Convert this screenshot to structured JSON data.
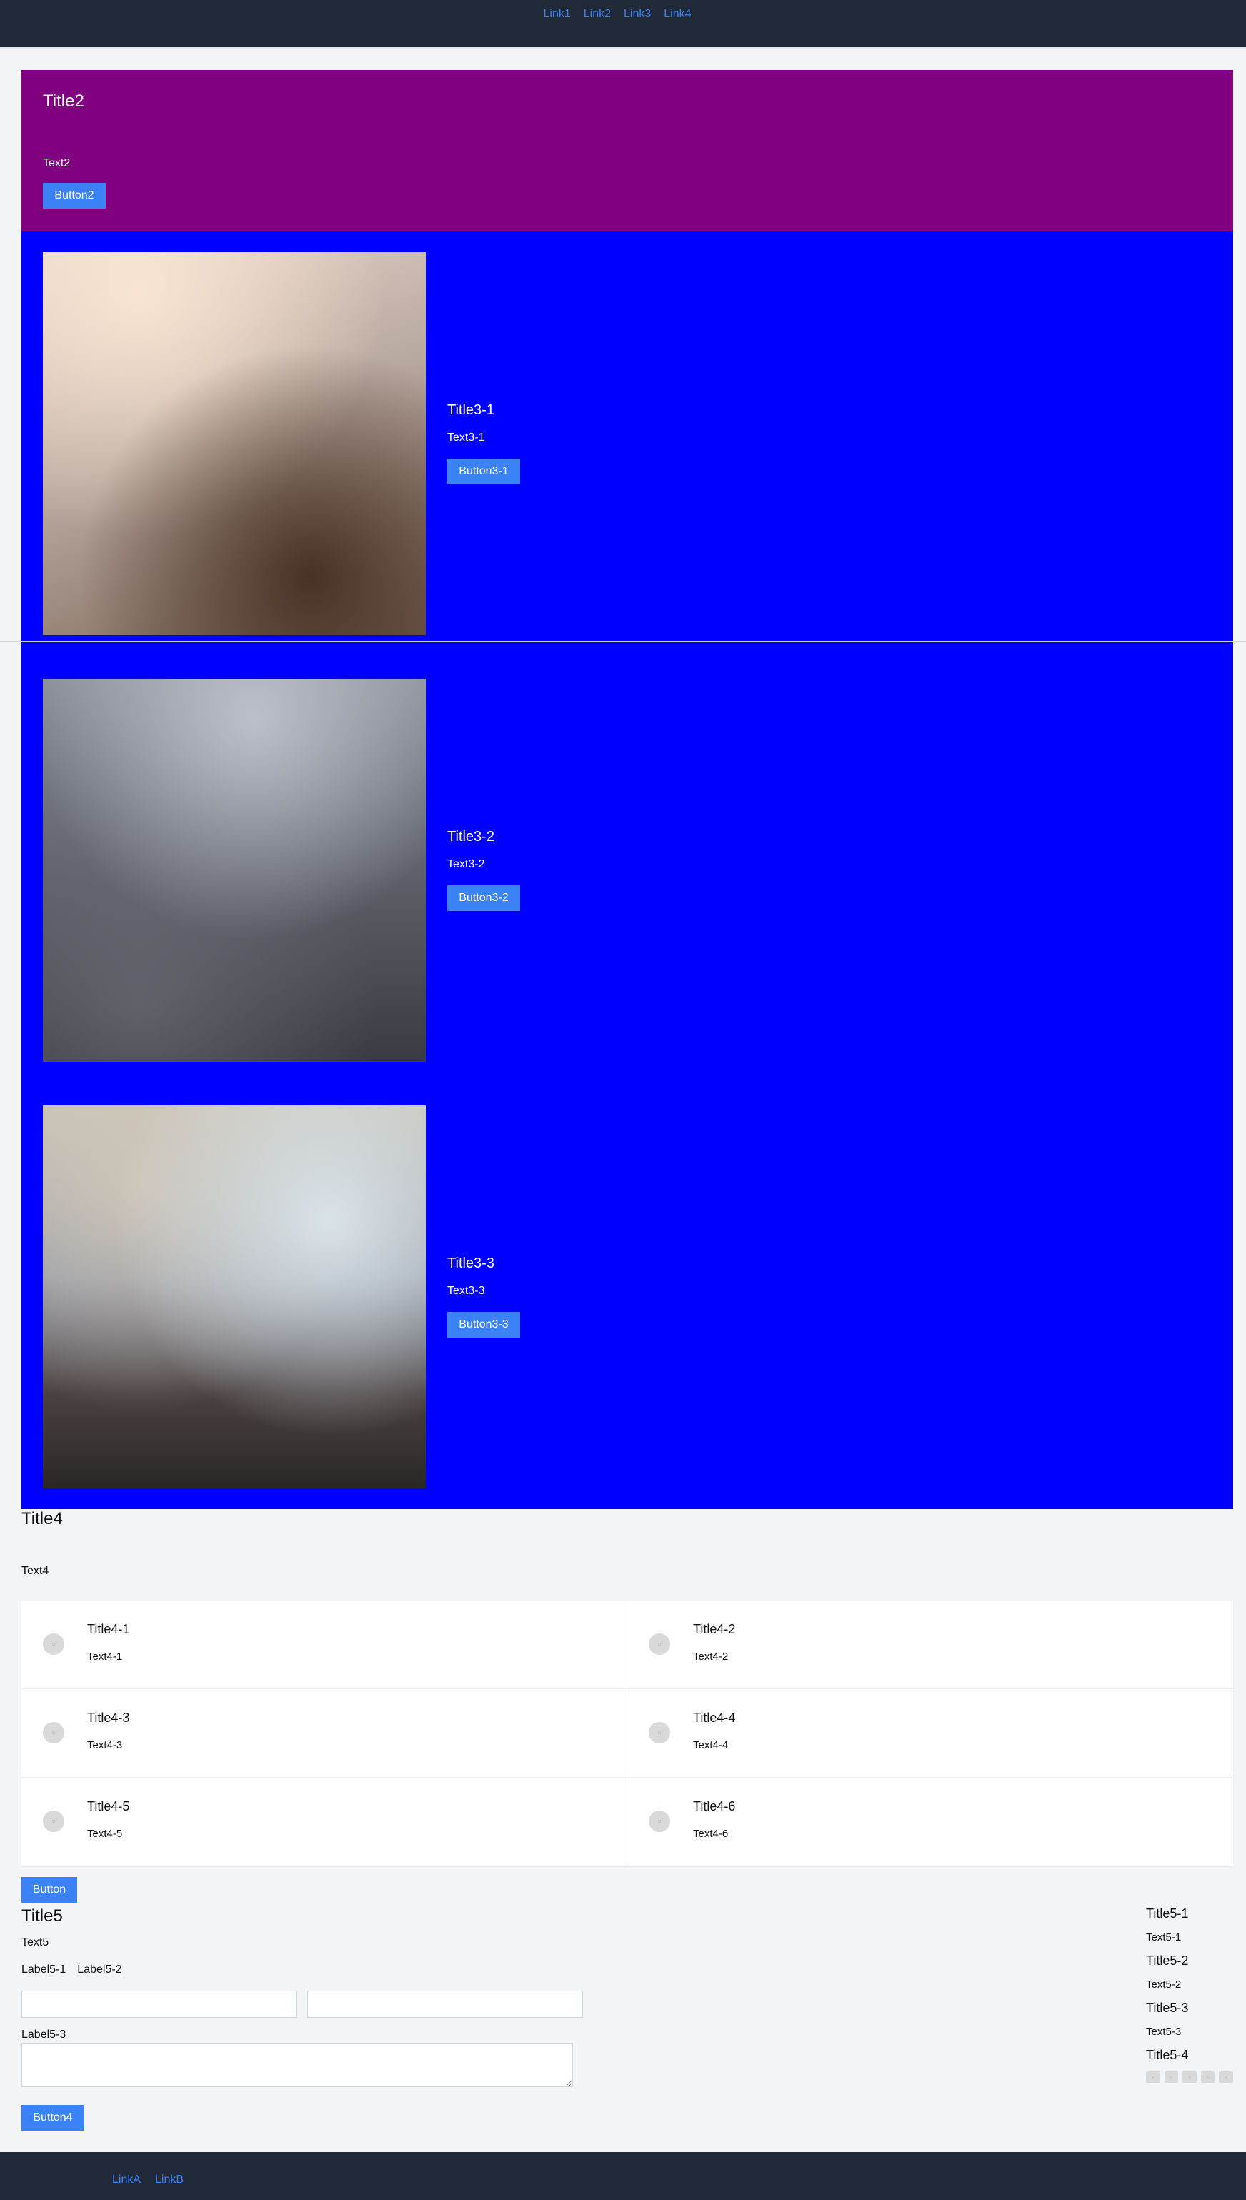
{
  "top_nav": {
    "links": [
      "Link1",
      "Link2",
      "Link3",
      "Link4"
    ]
  },
  "hero": {
    "title": "Title2",
    "text": "Text2",
    "button": "Button2"
  },
  "features": [
    {
      "title": "Title3-1",
      "text": "Text3-1",
      "button": "Button3-1"
    },
    {
      "title": "Title3-2",
      "text": "Text3-2",
      "button": "Button3-2"
    },
    {
      "title": "Title3-3",
      "text": "Text3-3",
      "button": "Button3-3"
    }
  ],
  "section4": {
    "title": "Title4",
    "text": "Text4",
    "items": [
      {
        "title": "Title4-1",
        "text": "Text4-1"
      },
      {
        "title": "Title4-2",
        "text": "Text4-2"
      },
      {
        "title": "Title4-3",
        "text": "Text4-3"
      },
      {
        "title": "Title4-4",
        "text": "Text4-4"
      },
      {
        "title": "Title4-5",
        "text": "Text4-5"
      },
      {
        "title": "Title4-6",
        "text": "Text4-6"
      }
    ]
  },
  "standalone_button": "Button",
  "section5": {
    "title": "Title5",
    "text": "Text5",
    "labels": [
      "Label5-1",
      "Label5-2"
    ],
    "label3": "Label5-3",
    "inputs": [
      {
        "value": "",
        "placeholder": ""
      },
      {
        "value": "",
        "placeholder": ""
      }
    ],
    "textarea": {
      "value": "",
      "placeholder": ""
    },
    "button": "Button4"
  },
  "aside": {
    "items": [
      {
        "title": "Title5-1",
        "text": "Text5-1"
      },
      {
        "title": "Title5-2",
        "text": "Text5-2"
      },
      {
        "title": "Title5-3",
        "text": "Text5-3"
      },
      {
        "title": "Title5-4"
      }
    ]
  },
  "footer": {
    "links": [
      "LinkA",
      "LinkB"
    ]
  },
  "colors": {
    "nav_bg": "#1f2937",
    "link": "#3b82f6",
    "hero_bg": "#800080",
    "features_bg": "#0000ff",
    "button_bg": "#3b82f6",
    "page_bg": "#f3f4f6"
  },
  "icons": {
    "feature_images": [
      "image-icon",
      "image-icon",
      "image-icon"
    ],
    "section4_avatars": [
      "avatar-icon",
      "avatar-icon",
      "avatar-icon",
      "avatar-icon",
      "avatar-icon",
      "avatar-icon"
    ]
  }
}
